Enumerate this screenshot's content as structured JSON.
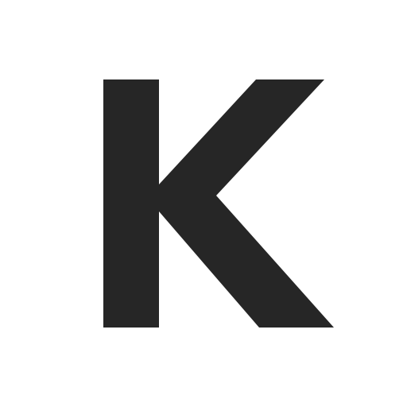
{
  "glyph": {
    "text": "K",
    "color": "#262626",
    "background": "#ffffff"
  }
}
